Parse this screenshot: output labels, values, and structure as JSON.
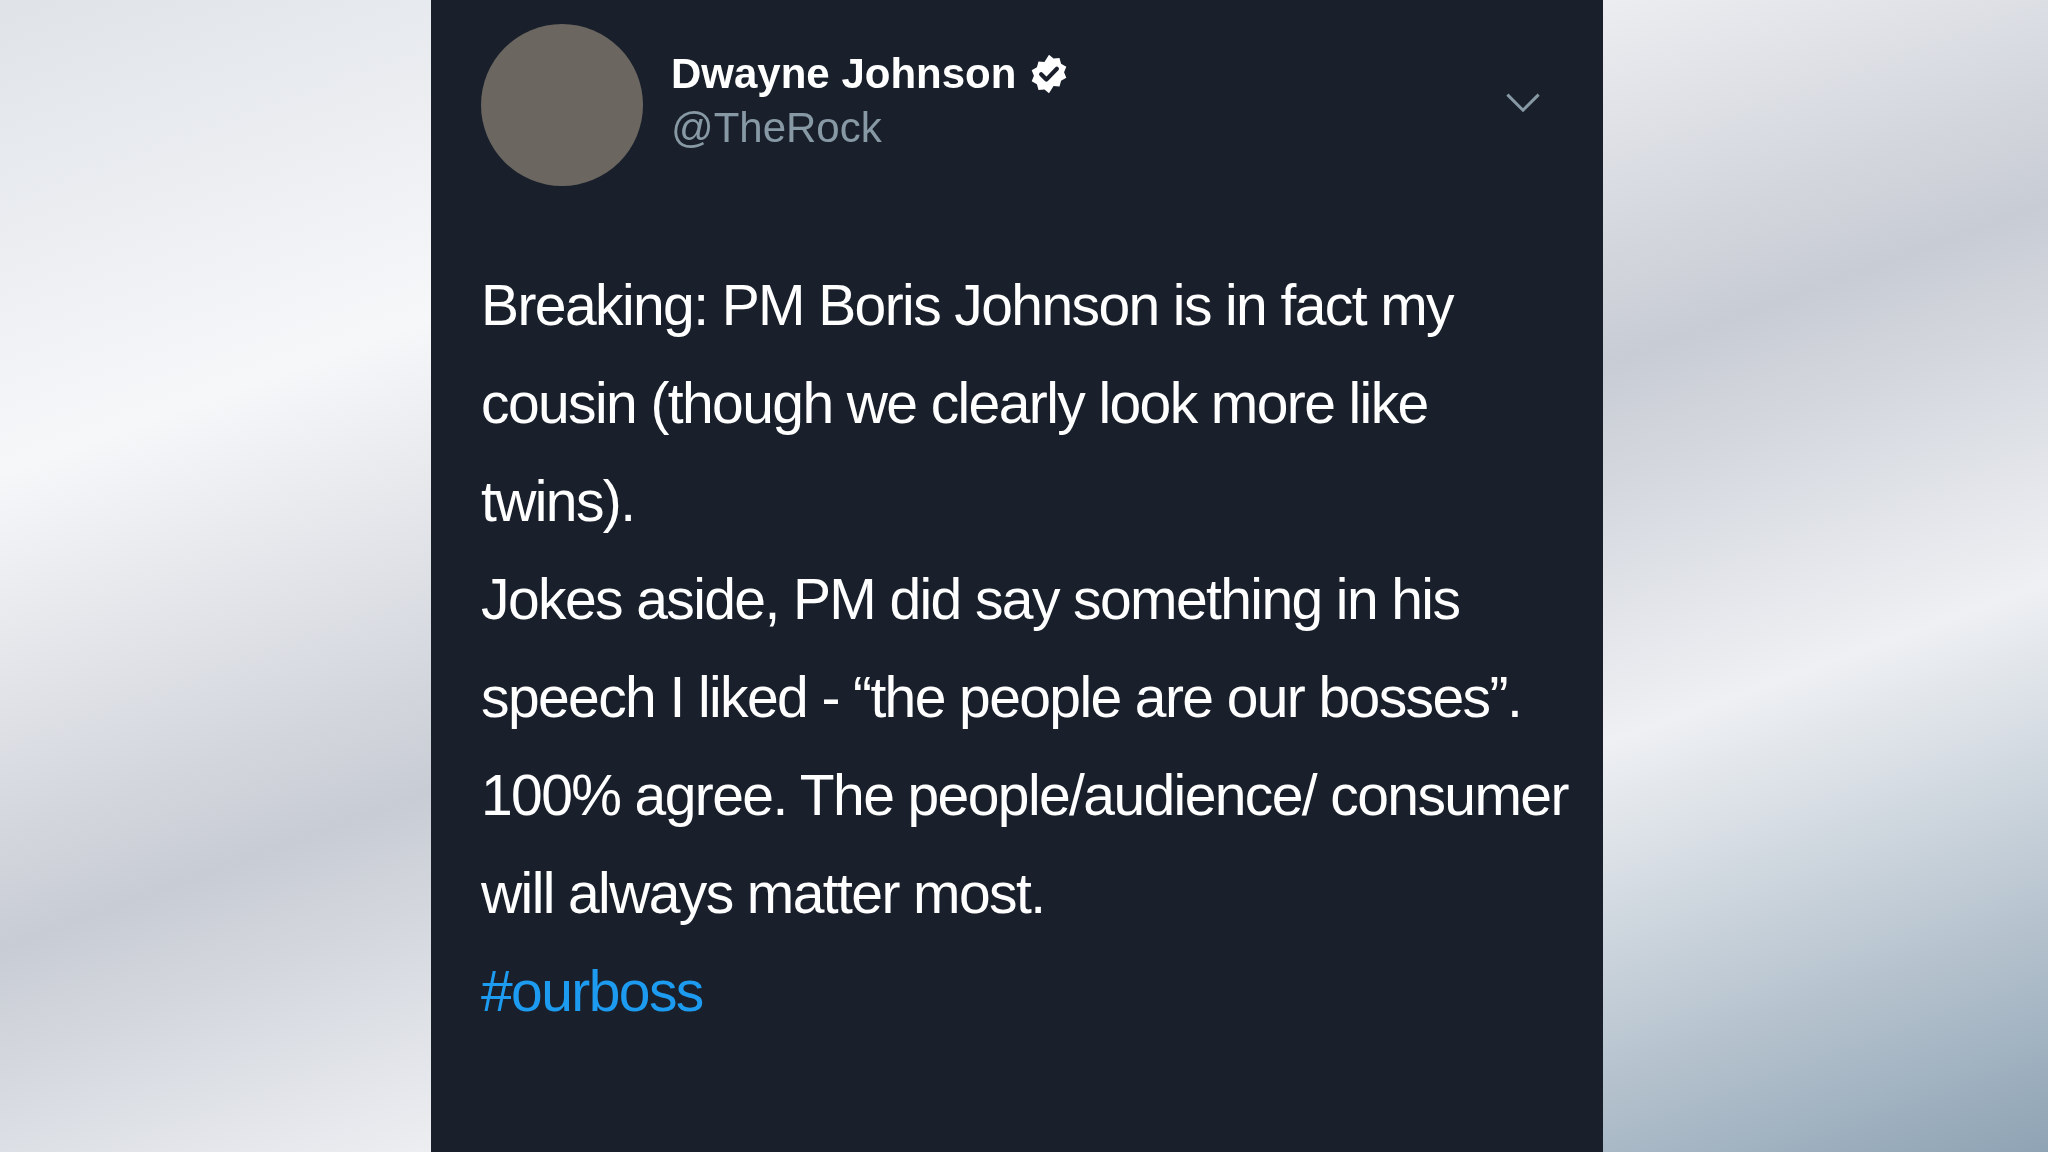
{
  "tweet": {
    "author": {
      "name": "Dwayne Johnson",
      "verified": true,
      "handle": "@TheRock"
    },
    "paragraphs": [
      "Breaking: PM Boris Johnson is in fact my cousin (though we clearly look more like twins).",
      "Jokes aside, PM did say something in his speech I liked - “the people are our bosses”.",
      "100% agree. The people/audience/ consumer will always matter most."
    ],
    "hashtag": "#ourboss"
  }
}
